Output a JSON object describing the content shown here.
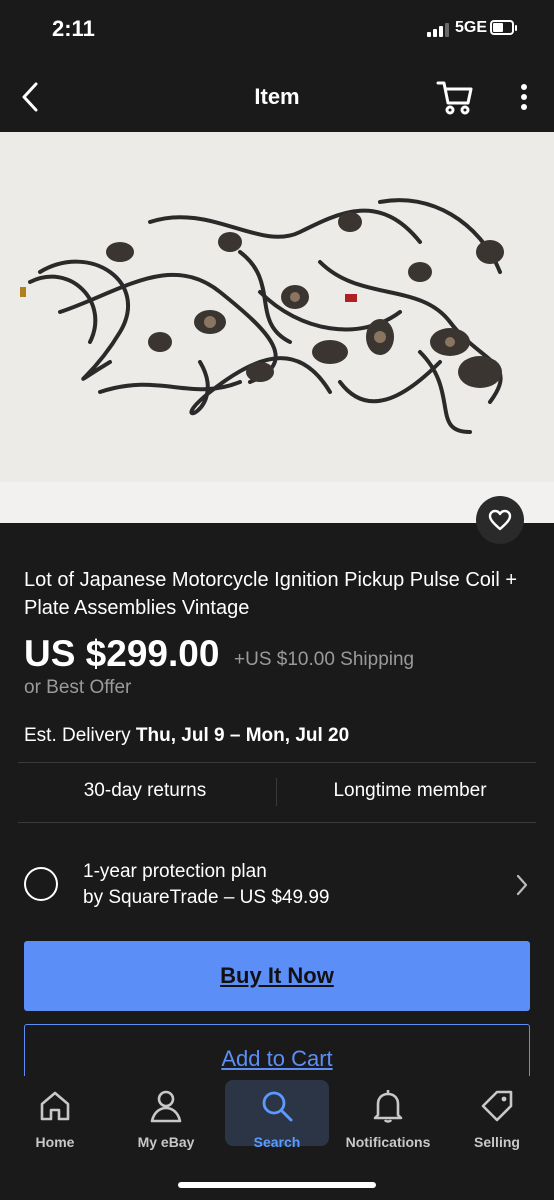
{
  "status": {
    "time": "2:11",
    "network": "5GE"
  },
  "nav": {
    "title": "Item",
    "back_icon": "chevron-left-icon",
    "cart_icon": "cart-icon",
    "more_icon": "more-vertical-icon"
  },
  "hero": {
    "favorite_icon": "heart-icon"
  },
  "listing": {
    "title": "Lot of Japanese Motorcycle Ignition Pickup Pulse Coil + Plate Assemblies Vintage",
    "price": "US $299.00",
    "shipping": "+US $10.00 Shipping",
    "best_offer": "or Best Offer",
    "delivery_label": "Est. Delivery",
    "delivery_dates": "Thu, Jul 9 – Mon, Jul 20"
  },
  "features": {
    "returns": "30-day returns",
    "member": "Longtime member"
  },
  "protection": {
    "line1": "1-year protection plan",
    "line2": "by SquareTrade – US $49.99"
  },
  "actions": {
    "buy_now": "Buy It Now",
    "add_to_cart": "Add to Cart"
  },
  "tabs": [
    {
      "label": "Home",
      "icon": "home-icon",
      "active": false
    },
    {
      "label": "My eBay",
      "icon": "user-icon",
      "active": false
    },
    {
      "label": "Search",
      "icon": "search-icon",
      "active": true
    },
    {
      "label": "Notifications",
      "icon": "bell-icon",
      "active": false
    },
    {
      "label": "Selling",
      "icon": "tag-icon",
      "active": false
    }
  ],
  "colors": {
    "background": "#1a1a1a",
    "accent": "#5b8ef7",
    "active_tab": "#5b9bff",
    "muted_text": "#9a9a9a"
  }
}
